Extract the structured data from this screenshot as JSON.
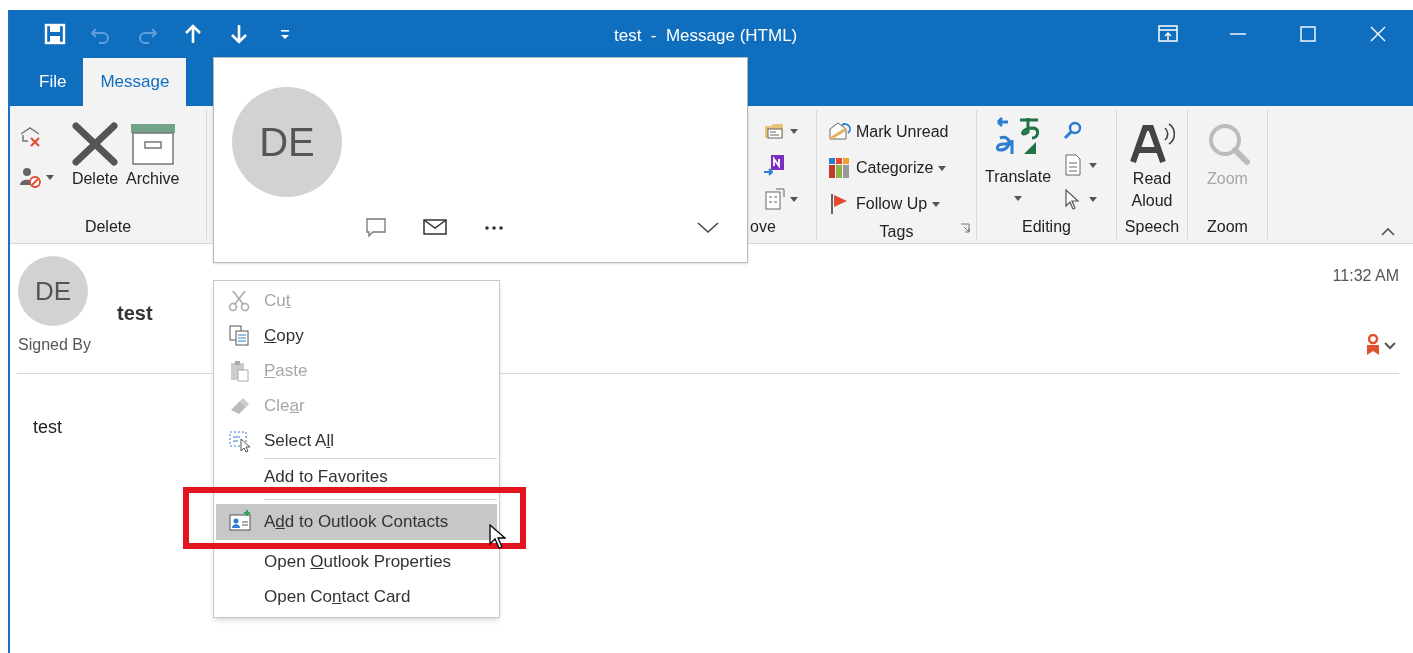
{
  "window": {
    "title": "test  -  Message (HTML)"
  },
  "quick_access": [
    {
      "kind": "save",
      "disabled": false
    },
    {
      "kind": "undo",
      "disabled": true
    },
    {
      "kind": "redo",
      "disabled": true
    },
    {
      "kind": "up",
      "disabled": false
    },
    {
      "kind": "down",
      "disabled": false
    },
    {
      "kind": "customize",
      "disabled": false
    }
  ],
  "window_controls": [
    {
      "kind": "ribbon-display"
    },
    {
      "kind": "minimize"
    },
    {
      "kind": "maximize"
    },
    {
      "kind": "close"
    }
  ],
  "tabs": [
    {
      "label": "File",
      "selected": false
    },
    {
      "label": "Message",
      "selected": true
    }
  ],
  "ribbon": {
    "groups": [
      {
        "kind": "delete",
        "label": "Delete",
        "items": [
          {
            "kind": "delete",
            "label": "Delete",
            "disabled": false
          },
          {
            "kind": "archive",
            "label": "Archive",
            "disabled": false
          }
        ]
      },
      {
        "kind": "move",
        "label": "ove"
      },
      {
        "kind": "tags",
        "label": "Tags",
        "items": [
          {
            "kind": "mark-unread",
            "label": "Mark Unread",
            "dropdown": false
          },
          {
            "kind": "categorize",
            "label": "Categorize",
            "dropdown": true
          },
          {
            "kind": "follow-up",
            "label": "Follow Up",
            "dropdown": true
          }
        ]
      },
      {
        "kind": "editing",
        "label": "Editing",
        "items": [
          {
            "kind": "translate",
            "label": "Translate",
            "disabled": false
          }
        ]
      },
      {
        "kind": "speech",
        "label": "Speech",
        "items": [
          {
            "kind": "read-aloud",
            "label": "Read\nAloud",
            "disabled": false
          }
        ]
      },
      {
        "kind": "zoom",
        "label": "Zoom",
        "items": [
          {
            "kind": "zoom",
            "label": "Zoom",
            "disabled": true
          }
        ]
      }
    ]
  },
  "message": {
    "initials": "DE",
    "subject": "test",
    "signed_by_label": "Signed By",
    "time": "11:32 AM",
    "body": "test"
  },
  "contact_card": {
    "initials": "DE",
    "actions": [
      {
        "kind": "chat"
      },
      {
        "kind": "mail"
      },
      {
        "kind": "more"
      },
      {
        "kind": "expand"
      }
    ]
  },
  "context_menu": {
    "items": [
      {
        "kind": "cut",
        "before": "Cu",
        "key": "t",
        "disabled": true,
        "selected": false
      },
      {
        "kind": "copy",
        "key": "C",
        "after": "opy",
        "disabled": false,
        "selected": false
      },
      {
        "kind": "paste",
        "key": "P",
        "after": "aste",
        "disabled": true,
        "selected": false
      },
      {
        "kind": "clear",
        "before": "Cle",
        "key": "a",
        "after": "r",
        "disabled": true,
        "selected": false
      },
      {
        "kind": "select-all",
        "before": "Select A",
        "key": "l",
        "after": "l",
        "disabled": false,
        "selected": false
      },
      {
        "kind": "separator"
      },
      {
        "kind": "plain",
        "before": "Add to Favorites",
        "disabled": false,
        "selected": false
      },
      {
        "kind": "separator"
      },
      {
        "kind": "add-contact",
        "before": "A",
        "key": "d",
        "after": "d to Outlook Contacts",
        "disabled": false,
        "selected": true
      },
      {
        "kind": "plain",
        "before": "Open ",
        "key": "O",
        "after": "utlook Properties",
        "disabled": false,
        "selected": false
      },
      {
        "kind": "plain",
        "before": "Open Co",
        "key": "n",
        "after": "tact Card",
        "disabled": false,
        "selected": false
      }
    ]
  }
}
